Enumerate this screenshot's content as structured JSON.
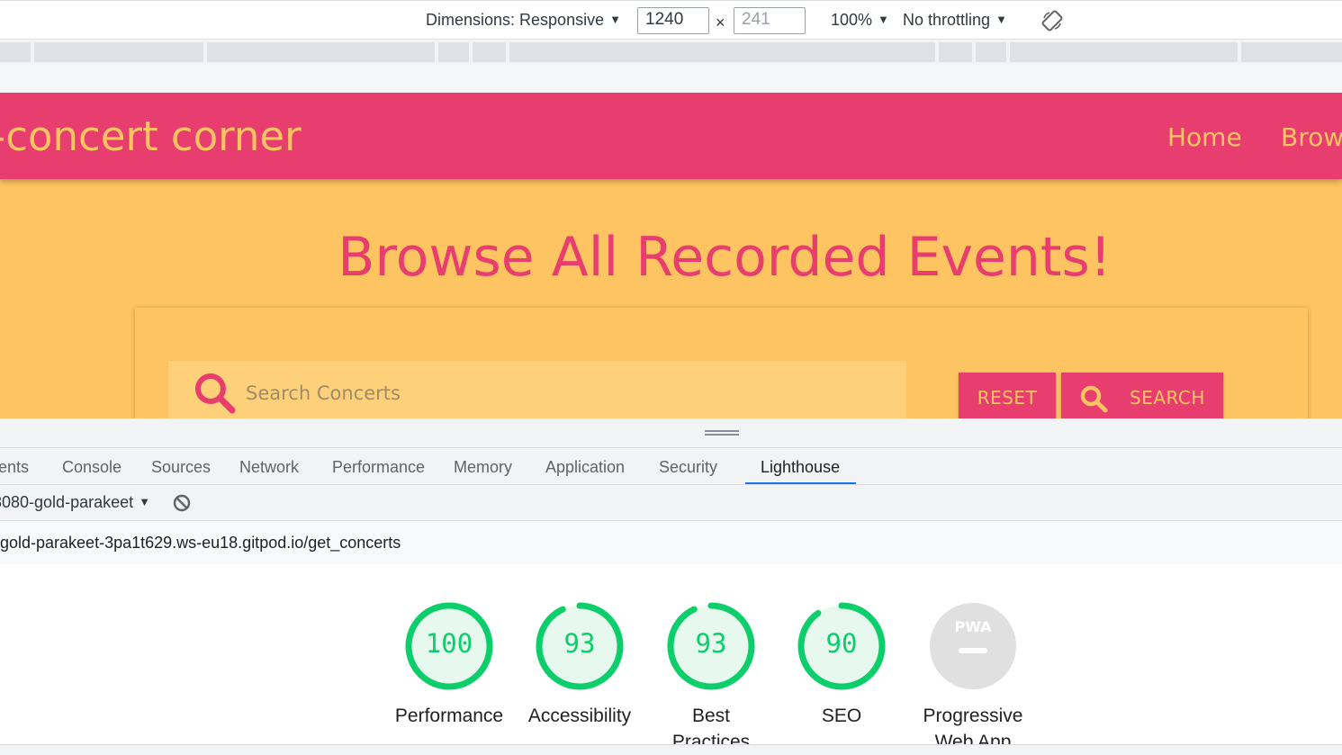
{
  "device_toolbar": {
    "dimensions_label": "Dimensions: Responsive",
    "width_value": "1240",
    "times": "×",
    "height_placeholder": "241",
    "zoom": "100%",
    "throttling": "No throttling",
    "rotate_icon": "rotate-icon"
  },
  "site": {
    "brand": "-concert corner",
    "nav": [
      "Home",
      "Brow"
    ],
    "heading": "Browse All Recorded Events!",
    "search_placeholder": "Search Concerts",
    "reset_label": "RESET",
    "search_label": "SEARCH",
    "colors": {
      "primary": "#e73d6f",
      "secondary": "#fec461"
    }
  },
  "devtools": {
    "tabs": [
      "ents",
      "Console",
      "Sources",
      "Network",
      "Performance",
      "Memory",
      "Application",
      "Security",
      "Lighthouse"
    ],
    "active_tab": "Lighthouse",
    "report_select": "8080-gold-parakeet",
    "report_url": "-gold-parakeet-3pa1t629.ws-eu18.gitpod.io/get_concerts"
  },
  "lighthouse": {
    "scores": [
      {
        "label": "Performance",
        "score": "100",
        "fraction": 1.0
      },
      {
        "label": "Accessibility",
        "score": "93",
        "fraction": 0.93
      },
      {
        "label": "Best Practices",
        "score": "93",
        "fraction": 0.93
      },
      {
        "label": "SEO",
        "score": "90",
        "fraction": 0.9
      }
    ],
    "pwa": {
      "badge": "PWA",
      "label": "Progressive Web App"
    },
    "pass_color": "#0cce6b"
  }
}
